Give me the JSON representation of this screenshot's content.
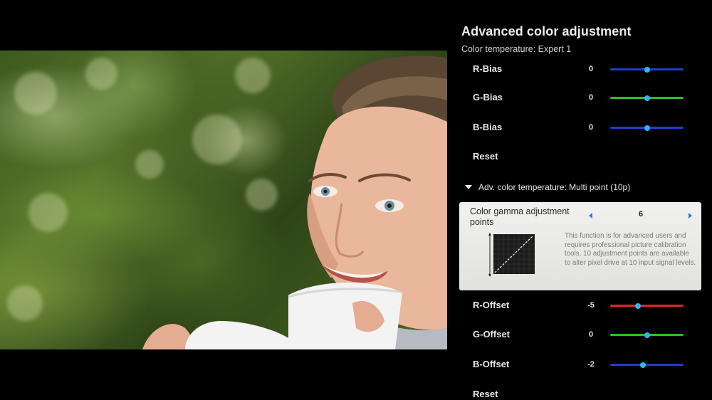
{
  "panel": {
    "title": "Advanced color adjustment",
    "subtitle": "Color temperature: Expert 1"
  },
  "menu": {
    "items": [
      {
        "label": "R-Bias",
        "value": "0",
        "slider_color": "#1f3fd0",
        "level_fraction": 0.5
      },
      {
        "label": "G-Bias",
        "value": "0",
        "slider_color": "#2fbe28",
        "level_fraction": 0.5
      },
      {
        "label": "B-Bias",
        "value": "0",
        "slider_color": "#1f3fd0",
        "level_fraction": 0.5
      },
      {
        "label": "Reset"
      },
      {
        "label": "Adv. color temperature: Multi point (10p)"
      },
      {
        "label": "R-Offset",
        "value": "-5",
        "slider_color": "#e0262c",
        "level_fraction": 0.375
      },
      {
        "label": "G-Offset",
        "value": "0",
        "slider_color": "#2fbe28",
        "level_fraction": 0.5
      },
      {
        "label": "B-Offset",
        "value": "-2",
        "slider_color": "#1f3fd0",
        "level_fraction": 0.45
      },
      {
        "label": "Reset"
      }
    ]
  },
  "focused": {
    "label": "Color gamma adjustment points",
    "value": "6",
    "description": "This function is for advanced users and requires professional picture calibration tools. 10 adjustment points are available to alter pixel drive at 10 input signal levels.",
    "icons": {
      "left": "arrow-left-icon",
      "right": "arrow-right-icon",
      "graph": "gamma-curve-icon"
    }
  },
  "colors": {
    "accent": "#36b4f0",
    "red": "#e0262c",
    "green": "#2fbe28",
    "blue": "#1f3fd0"
  }
}
